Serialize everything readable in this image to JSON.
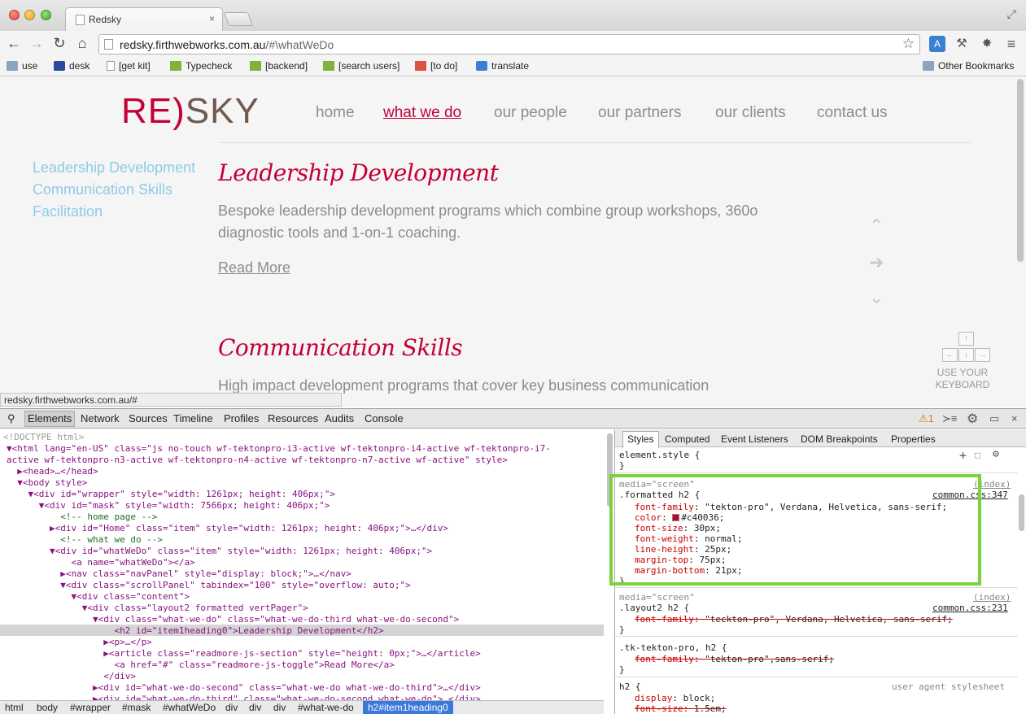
{
  "window": {
    "tab_title": "Redsky",
    "tab_close": "×",
    "fullscreen_glyph": "⤢"
  },
  "toolbar": {
    "back": "←",
    "forward": "→",
    "reload": "↻",
    "home": "⌂",
    "url_host": "redsky.firthwebworks.com.au",
    "url_rest": "/#\\whatWeDo",
    "star": "☆",
    "translate": "A",
    "wrench": "⚒",
    "ext": "✸",
    "menu": "≡"
  },
  "bookmarks": {
    "items": [
      {
        "label": "use",
        "icon": "folder-icon"
      },
      {
        "label": "desk",
        "icon": "d-icon"
      },
      {
        "label": "[get kit]",
        "icon": "page-icon"
      },
      {
        "label": "Typecheck",
        "icon": "yeoman-icon"
      },
      {
        "label": "[backend]",
        "icon": "yeoman-icon"
      },
      {
        "label": "[search users]",
        "icon": "yeoman-icon"
      },
      {
        "label": "[to do]",
        "icon": "todo-icon"
      },
      {
        "label": "translate",
        "icon": "translate-icon"
      }
    ],
    "other": "Other Bookmarks"
  },
  "page": {
    "logo_left": "RE",
    "logo_mid": ")",
    "logo_right": "SKY",
    "nav": [
      "home",
      "what we do",
      "our people",
      "our partners",
      "our clients",
      "contact us"
    ],
    "active_nav": "what we do",
    "subnav": [
      "Leadership Development",
      "Communication Skills",
      "Facilitation"
    ],
    "sections": [
      {
        "heading": "Leadership Development",
        "body": "Bespoke leadership development programs which combine group workshops, 360o diagnostic tools and 1-on-1 coaching."
      },
      {
        "heading": "Communication Skills",
        "body": "High impact development programs that cover key business communication"
      }
    ],
    "read_more": "Read More",
    "pager_up": "⌃",
    "pager_next": "➜",
    "pager_down": "⌄",
    "keys": {
      "up": "↑",
      "left": "←",
      "down": "↓",
      "right": "→"
    },
    "keyboard_label_1": "USE YOUR",
    "keyboard_label_2": "KEYBOARD",
    "status_url": "redsky.firthwebworks.com.au/#"
  },
  "devtools": {
    "tabs": [
      "Elements",
      "Network",
      "Sources",
      "Timeline",
      "Profiles",
      "Resources",
      "Audits",
      "Console"
    ],
    "selected_tab": "Elements",
    "warnings": "⚠1",
    "elements_lines": [
      "<!DOCTYPE html>",
      "▼<html lang=\"en-US\" class=\"js no-touch wf-tektonpro-i3-active wf-tektonpro-i4-active wf-tektonpro-i7-",
      "active wf-tektonpro-n3-active wf-tektonpro-n4-active wf-tektonpro-n7-active wf-active\" style>",
      "  ▶<head>…</head>",
      "  ▼<body style>",
      "    ▼<div id=\"wrapper\" style=\"width: 1261px; height: 406px;\">",
      "      ▼<div id=\"mask\" style=\"width: 7566px; height: 406px;\">",
      "          <!-- home page -->",
      "        ▶<div id=\"Home\" class=\"item\" style=\"width: 1261px; height: 406px;\">…</div>",
      "          <!-- what we do -->",
      "        ▼<div id=\"whatWeDo\" class=\"item\" style=\"width: 1261px; height: 406px;\">",
      "            <a name=\"whatWeDo\"></a>",
      "          ▶<nav class=\"navPanel\" style=\"display: block;\">…</nav>",
      "          ▼<div class=\"scrollPanel\" tabindex=\"100\" style=\"overflow: auto;\">",
      "            ▼<div class=\"content\">",
      "              ▼<div class=\"layout2 formatted vertPager\">",
      "                ▼<div class=\"what-we-do\" class=\"what-we-do-third what-we-do-second\">",
      "                    <h2 id=\"item1heading0\">Leadership Development</h2>",
      "                  ▶<p>…</p>",
      "                  ▶<article class=\"readmore-js-section\" style=\"height: 0px;\">…</article>",
      "                    <a href=\"#\" class=\"readmore-js-toggle\">Read More</a>",
      "                  </div>",
      "                ▶<div id=\"what-we-do-second\" class=\"what-we-do what-we-do-third\">…</div>",
      "                ▶<div id=\"what-we-do-third\" class=\"what-we-do-second what-we-do\">…</div>"
    ],
    "breadcrumbs": [
      "html",
      "body",
      "#wrapper",
      "#mask",
      "#whatWeDo",
      "div",
      "div",
      "div",
      "#what-we-do",
      "h2#item1heading0"
    ],
    "sidebar_tabs": [
      "Styles",
      "Computed",
      "Event Listeners",
      "DOM Breakpoints",
      "Properties"
    ],
    "styles": {
      "element_style": "element.style {",
      "close": "}",
      "rule1": {
        "media": "media=\"screen\"",
        "origin": "(index)",
        "selector": ".formatted h2 {",
        "source": "common.css:347",
        "props": [
          {
            "name": "font-family",
            "value": "\"tekton-pro\", Verdana, Helvetica, sans-serif;"
          },
          {
            "name": "color",
            "value": "#c40036;"
          },
          {
            "name": "font-size",
            "value": "30px;"
          },
          {
            "name": "font-weight",
            "value": "normal;"
          },
          {
            "name": "line-height",
            "value": "25px;"
          },
          {
            "name": "margin-top",
            "value": "75px;"
          },
          {
            "name": "margin-bottom",
            "value": "21px;"
          }
        ]
      },
      "rule2": {
        "media": "media=\"screen\"",
        "origin": "(index)",
        "selector": ".layout2 h2 {",
        "source": "common.css:231",
        "props": [
          {
            "name": "font-family",
            "value": "\"teckton-pro\", Verdana, Helvetica, sans-serif;"
          }
        ]
      },
      "rule3": {
        "selector": ".tk-tekton-pro, h2 {",
        "props": [
          {
            "name": "font-family",
            "value": "\"tekton-pro\",sans-serif;"
          }
        ]
      },
      "rule4": {
        "selector": "h2 {",
        "origin": "user agent stylesheet",
        "props": [
          {
            "name": "display",
            "value": "block;"
          },
          {
            "name": "font-size",
            "value": "1.5em;"
          }
        ]
      }
    }
  },
  "colors": {
    "brand_red": "#c40036",
    "subnav_blue": "#8fcbe4",
    "highlight_green": "#7bd23a"
  }
}
